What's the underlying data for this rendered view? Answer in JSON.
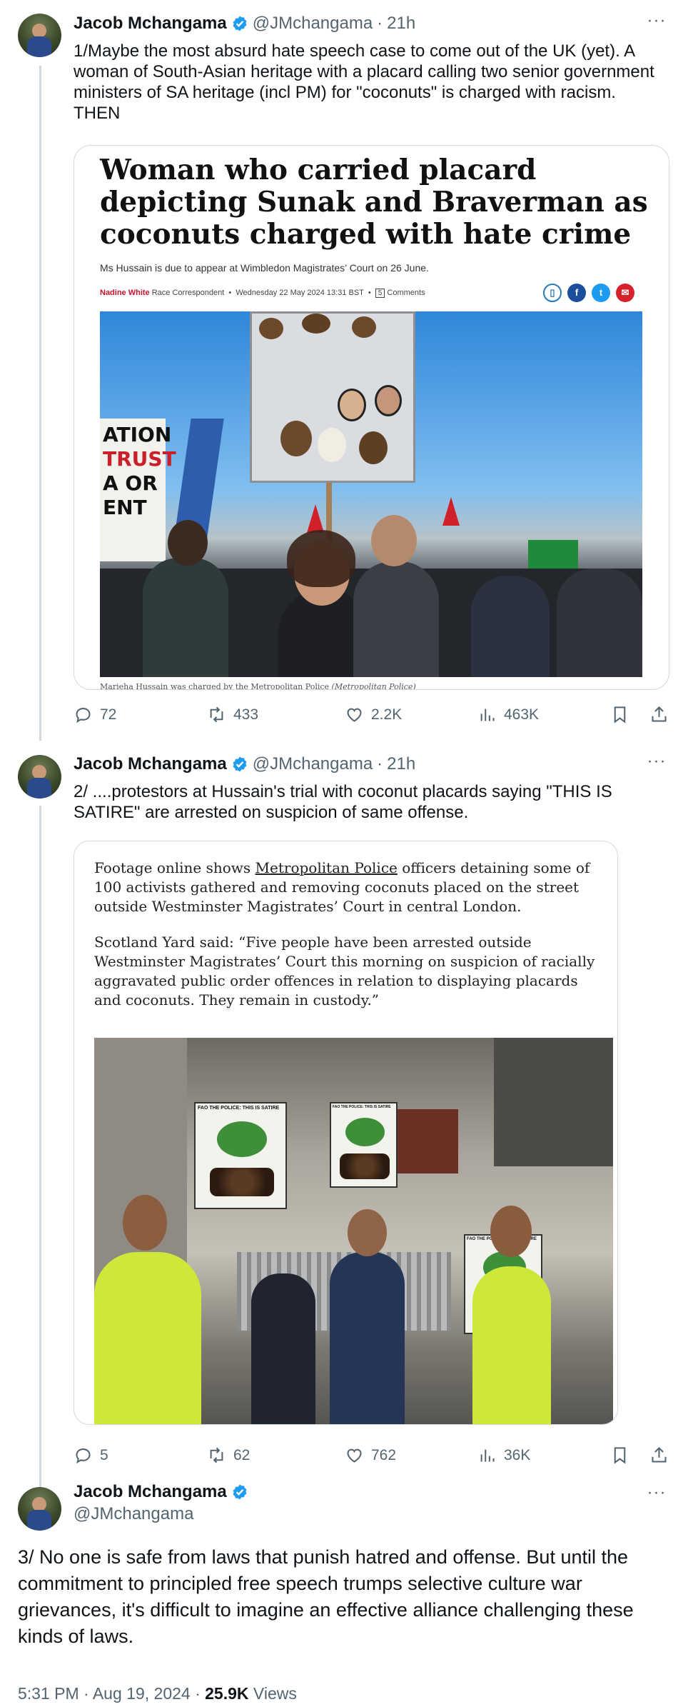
{
  "author": {
    "name": "Jacob Mchangama",
    "handle": "@JMchangama"
  },
  "tweet1": {
    "time": "21h",
    "text": "1/Maybe the most absurd hate speech case to come out of the UK (yet). A woman of South-Asian heritage with a placard calling two senior government ministers of SA heritage (incl PM) for \"coconuts\" is charged with racism. THEN",
    "article": {
      "headline": "Woman who carried placard depicting Sunak and Braverman as coconuts charged with hate crime",
      "standfirst": "Ms Hussain is due to appear at Wimbledon Magistrates’ Court on 26 June.",
      "author": "Nadine White",
      "role": "Race Correspondent",
      "date": "Wednesday 22 May 2024 13:31 BST",
      "comments_count": "5",
      "comments_label": "Comments",
      "caption": "Marieha Hussain was charged by the Metropolitan Police",
      "caption_credit": "(Metropolitan Police)",
      "sign_text": [
        "ATION",
        "TRUST",
        "A OR",
        "ENT"
      ]
    },
    "stats": {
      "replies": "72",
      "reposts": "433",
      "likes": "2.2K",
      "views": "463K"
    }
  },
  "tweet2": {
    "time": "21h",
    "text": "2/ ....protestors at Hussain's trial with coconut placards saying \"THIS IS SATIRE\" are arrested on suspicion of same offense.",
    "article": {
      "p1_before": "Footage online shows ",
      "p1_link": "Metropolitan Police",
      "p1_after": " officers detaining some of 100 activists gathered and removing coconuts placed on the street outside Westminster Magistrates’ Court in central London.",
      "p2": "Scotland Yard said: “Five people have been arrested outside Westminster Magistrates’ Court this morning on suspicion of racially aggravated public order offences in relation to displaying placards and coconuts. They remain in custody.”",
      "placard_text": "FAO THE POLICE: THIS IS SATIRE"
    },
    "stats": {
      "replies": "5",
      "reposts": "62",
      "likes": "762",
      "views": "36K"
    }
  },
  "tweet3": {
    "text": "3/ No one is safe from laws that punish hatred and offense. But until the commitment to principled free speech trumps selective culture war grievances, it's difficult to imagine an effective alliance challenging these kinds of laws.",
    "time": "5:31 PM",
    "date": "Aug 19, 2024",
    "views": "25.9K",
    "views_label": "Views"
  },
  "colors": {
    "text": "#0f1419",
    "secondary": "#536471",
    "verified": "#1d9bf0",
    "border": "#cfd9de"
  }
}
